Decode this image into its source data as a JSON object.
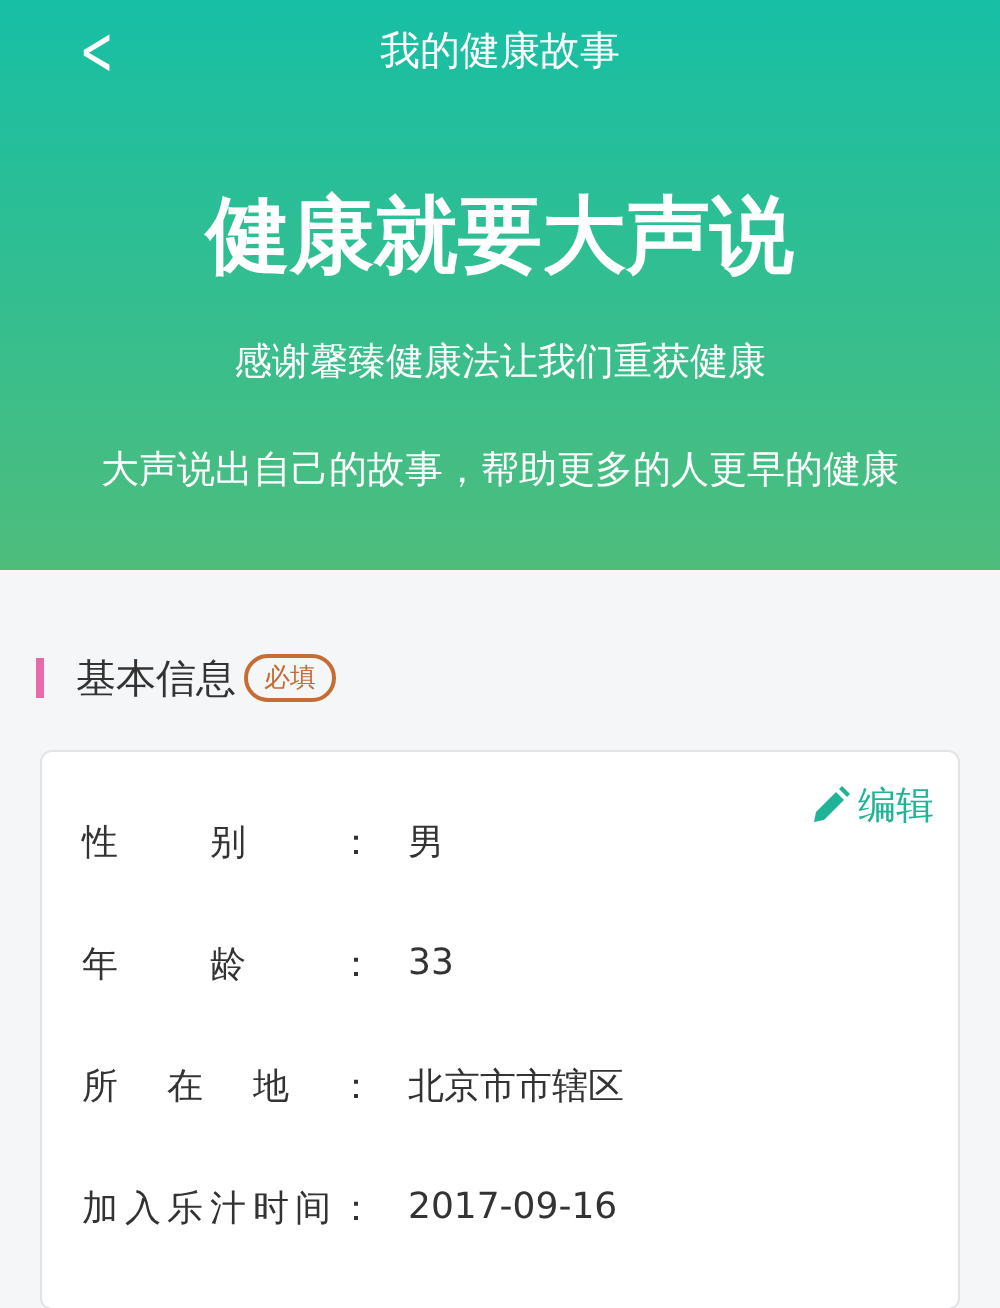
{
  "nav": {
    "back": "<",
    "title": "我的健康故事"
  },
  "banner": {
    "headline": "健康就要大声说",
    "lines": [
      "感谢馨臻健康法让我们重获健康",
      "大声说出自己的故事，帮助更多的人更早的健康"
    ]
  },
  "section": {
    "title": "基本信息",
    "badge": "必填"
  },
  "card": {
    "edit": "编辑",
    "fields": [
      {
        "label": "性别：",
        "value": "男"
      },
      {
        "label": "年龄：",
        "value": "33"
      },
      {
        "label": "所在地：",
        "value": "北京市市辖区"
      },
      {
        "label": "加入乐汁时间：",
        "value": "2017-09-16"
      }
    ]
  }
}
